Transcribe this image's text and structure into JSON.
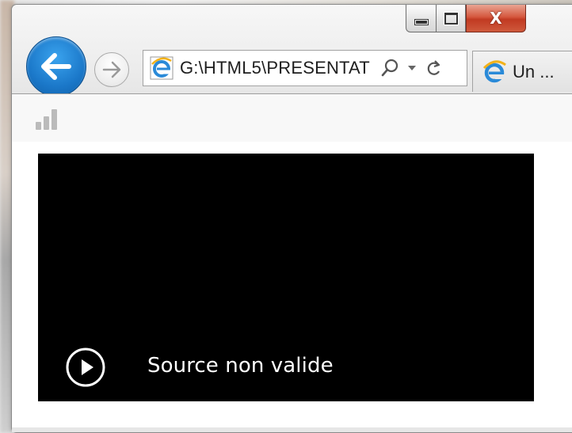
{
  "browser": {
    "address_bar": {
      "url": "G:\\HTML5\\PRESENTAT"
    },
    "tab": {
      "label": "Un ..."
    },
    "caption": {
      "close_glyph": "X"
    },
    "colors": {
      "back_button": "#1b78c9",
      "close_button": "#c13a22"
    },
    "icons": [
      "back-arrow-icon",
      "forward-arrow-icon",
      "ie-icon",
      "search-icon",
      "dropdown-icon",
      "refresh-icon",
      "signal-bars-icon",
      "play-icon"
    ]
  },
  "content": {
    "video": {
      "message": "Source non valide",
      "background": "#000000"
    }
  }
}
